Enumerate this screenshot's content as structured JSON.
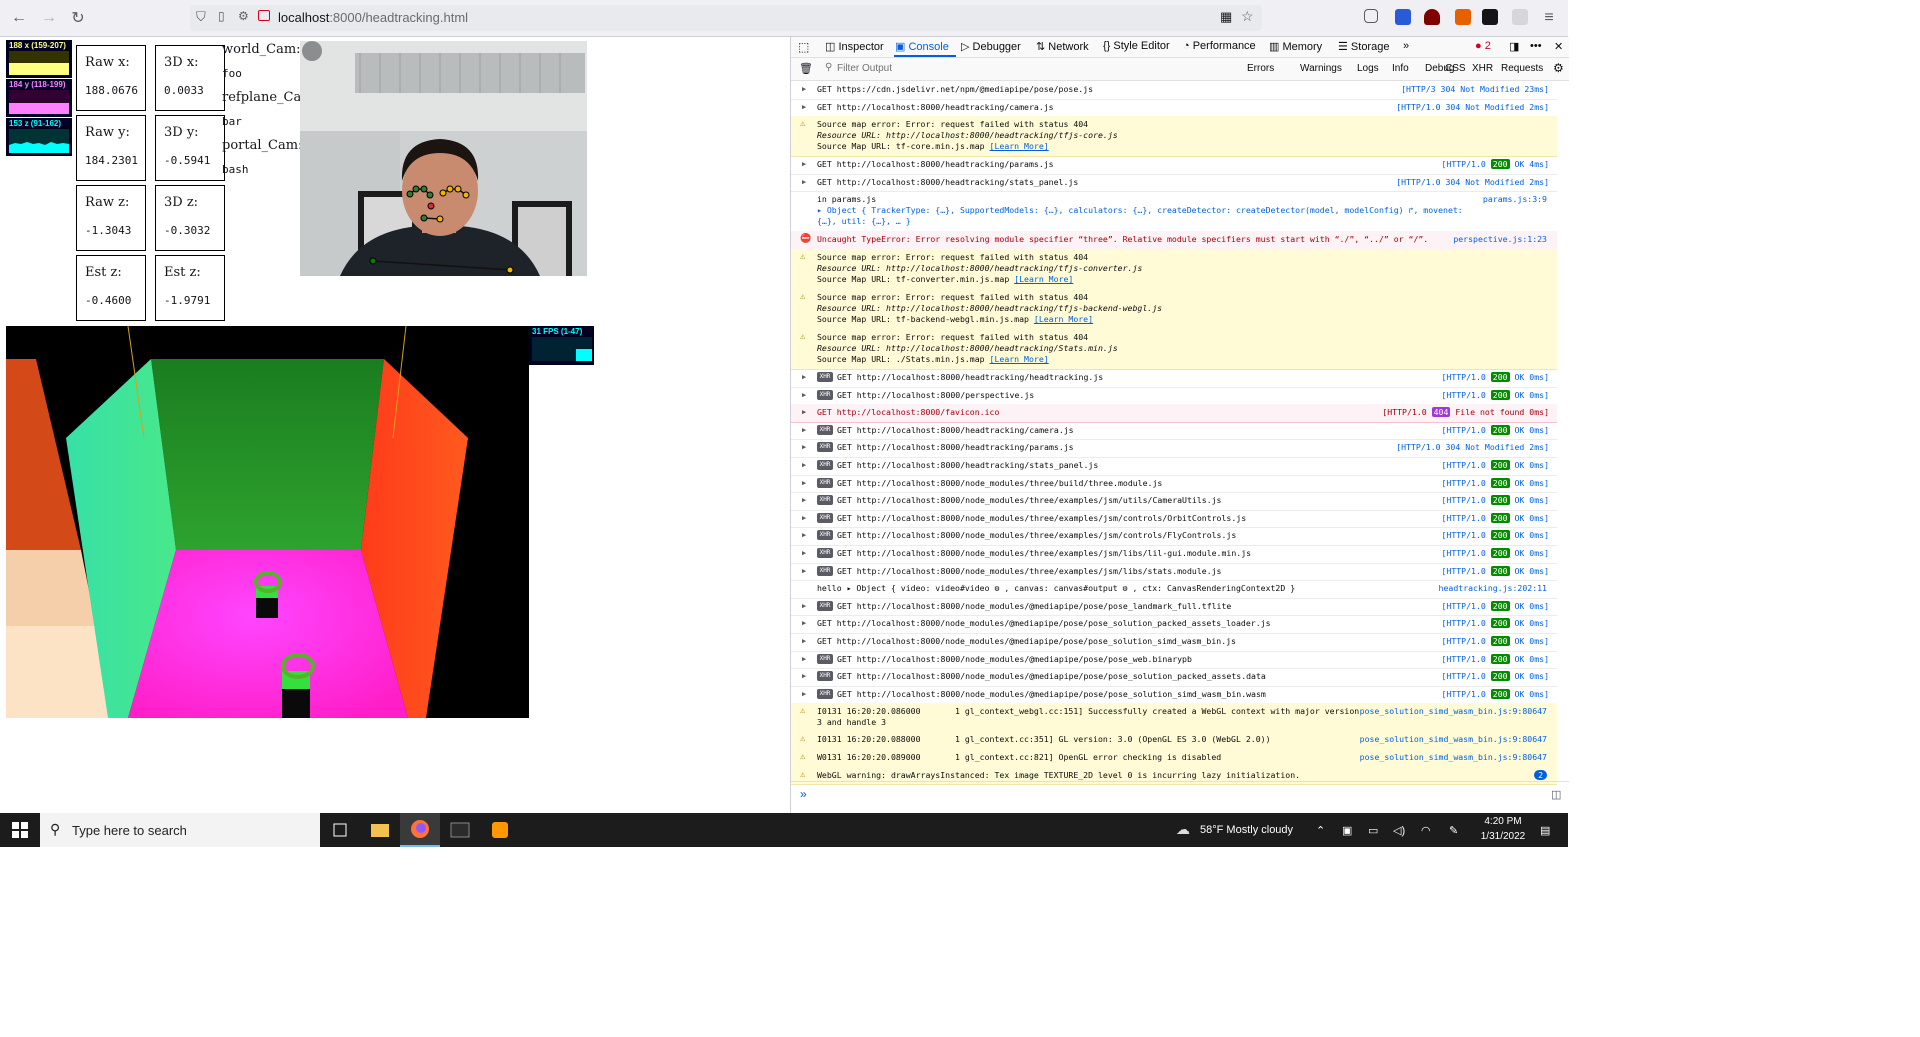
{
  "browser": {
    "url_host": "localhost",
    "url_path": ":8000/headtracking.html"
  },
  "stats_panels": [
    {
      "label": "188 x (159-207)",
      "color": "#ffff80"
    },
    {
      "label": "184 y (118-199)",
      "color": "#ff80ff"
    },
    {
      "label": "153 z (91-162)",
      "color": "#00ffff"
    }
  ],
  "readouts": [
    [
      {
        "label": "Raw x:",
        "value": "188.0676"
      },
      {
        "label": "3D x:",
        "value": "0.0033"
      }
    ],
    [
      {
        "label": "Raw y:",
        "value": "184.2301"
      },
      {
        "label": "3D y:",
        "value": "-0.5941"
      }
    ],
    [
      {
        "label": "Raw z:",
        "value": "-1.3043"
      },
      {
        "label": "3D z:",
        "value": "-0.3032"
      }
    ],
    [
      {
        "label": "Est z:",
        "value": "-0.4600"
      },
      {
        "label": "Est z:",
        "value": "-1.9791"
      }
    ]
  ],
  "cams": [
    {
      "label": "world_Cam:",
      "value": "foo"
    },
    {
      "label": "refplane_Cam:",
      "value": "bar"
    },
    {
      "label": "portal_Cam:",
      "value": "bash"
    }
  ],
  "fps_label": "31 FPS (1-47)",
  "devtools": {
    "tabs": [
      "Inspector",
      "Console",
      "Debugger",
      "Network",
      "Style Editor",
      "Performance",
      "Memory",
      "Storage"
    ],
    "error_count": "2",
    "filter_placeholder": "Filter Output",
    "filters": [
      "Errors",
      "Warnings",
      "Logs",
      "Info",
      "Debug",
      "CSS",
      "XHR",
      "Requests"
    ],
    "rows": [
      {
        "kind": "get",
        "xhr": false,
        "text": "GET https://cdn.jsdelivr.net/npm/@mediapipe/pose/pose.js",
        "status": "[HTTP/3 304 Not Modified 23ms]",
        "badge": ""
      },
      {
        "kind": "get",
        "xhr": false,
        "text": "GET http://localhost:8000/headtracking/camera.js",
        "status": "[HTTP/1.0 304 Not Modified 2ms]",
        "badge": ""
      },
      {
        "kind": "warn3",
        "lines": [
          "Source map error: Error: request failed with status 404",
          "Resource URL: http://localhost:8000/headtracking/tfjs-core.js",
          "Source Map URL: tf-core.min.js.map "
        ],
        "learn": "[Learn More]"
      },
      {
        "kind": "get",
        "xhr": false,
        "text": "GET http://localhost:8000/headtracking/params.js",
        "status_pre": "[HTTP/1.0 ",
        "badge": "200",
        "status_post": " OK 4ms]"
      },
      {
        "kind": "get",
        "xhr": false,
        "text": "GET http://localhost:8000/headtracking/stats_panel.js",
        "status": "[HTTP/1.0 304 Not Modified 2ms]",
        "badge": ""
      },
      {
        "kind": "log",
        "lines": [
          "in params.js",
          "▸ Object { TrackerType: {…}, SupportedModels: {…}, calculators: {…}, createDetector: createDetector(model, modelConfig) ↱, movenet:",
          "{…}, util: {…}, … }"
        ],
        "src": "params.js:3:9"
      },
      {
        "kind": "error",
        "text": "Uncaught TypeError: Error resolving module specifier “three”. Relative module specifiers must start with “./”, “../” or “/”.",
        "src": "perspective.js:1:23"
      },
      {
        "kind": "warn3",
        "lines": [
          "Source map error: Error: request failed with status 404",
          "Resource URL: http://localhost:8000/headtracking/tfjs-converter.js",
          "Source Map URL: tf-converter.min.js.map "
        ],
        "learn": "[Learn More]"
      },
      {
        "kind": "warn3",
        "lines": [
          "Source map error: Error: request failed with status 404",
          "Resource URL: http://localhost:8000/headtracking/tfjs-backend-webgl.js",
          "Source Map URL: tf-backend-webgl.min.js.map "
        ],
        "learn": "[Learn More]"
      },
      {
        "kind": "warn3",
        "lines": [
          "Source map error: Error: request failed with status 404",
          "Resource URL: http://localhost:8000/headtracking/Stats.min.js",
          "Source Map URL: ./Stats.min.js.map "
        ],
        "learn": "[Learn More]"
      },
      {
        "kind": "get",
        "xhr": true,
        "text": "GET http://localhost:8000/headtracking/headtracking.js",
        "status_pre": "[HTTP/1.0 ",
        "badge": "200",
        "status_post": " OK 0ms]"
      },
      {
        "kind": "get",
        "xhr": true,
        "text": "GET http://localhost:8000/perspective.js",
        "status_pre": "[HTTP/1.0 ",
        "badge": "200",
        "status_post": " OK 0ms]"
      },
      {
        "kind": "get404",
        "xhr": false,
        "text": "GET http://localhost:8000/favicon.ico",
        "status_pre": "[HTTP/1.0 ",
        "badge": "404",
        "status_post": " File not found 0ms]"
      },
      {
        "kind": "get",
        "xhr": true,
        "text": "GET http://localhost:8000/headtracking/camera.js",
        "status_pre": "[HTTP/1.0 ",
        "badge": "200",
        "status_post": " OK 0ms]"
      },
      {
        "kind": "get",
        "xhr": true,
        "text": "GET http://localhost:8000/headtracking/params.js",
        "status": "[HTTP/1.0 304 Not Modified 2ms]",
        "badge": ""
      },
      {
        "kind": "get",
        "xhr": true,
        "text": "GET http://localhost:8000/headtracking/stats_panel.js",
        "status_pre": "[HTTP/1.0 ",
        "badge": "200",
        "status_post": " OK 0ms]"
      },
      {
        "kind": "get",
        "xhr": true,
        "text": "GET http://localhost:8000/node_modules/three/build/three.module.js",
        "status_pre": "[HTTP/1.0 ",
        "badge": "200",
        "status_post": " OK 0ms]"
      },
      {
        "kind": "get",
        "xhr": true,
        "text": "GET http://localhost:8000/node_modules/three/examples/jsm/utils/CameraUtils.js",
        "status_pre": "[HTTP/1.0 ",
        "badge": "200",
        "status_post": " OK 0ms]"
      },
      {
        "kind": "get",
        "xhr": true,
        "text": "GET http://localhost:8000/node_modules/three/examples/jsm/controls/OrbitControls.js",
        "status_pre": "[HTTP/1.0 ",
        "badge": "200",
        "status_post": " OK 0ms]"
      },
      {
        "kind": "get",
        "xhr": true,
        "text": "GET http://localhost:8000/node_modules/three/examples/jsm/controls/FlyControls.js",
        "status_pre": "[HTTP/1.0 ",
        "badge": "200",
        "status_post": " OK 0ms]"
      },
      {
        "kind": "get",
        "xhr": true,
        "text": "GET http://localhost:8000/node_modules/three/examples/jsm/libs/lil-gui.module.min.js",
        "status_pre": "[HTTP/1.0 ",
        "badge": "200",
        "status_post": " OK 0ms]"
      },
      {
        "kind": "get",
        "xhr": true,
        "text": "GET http://localhost:8000/node_modules/three/examples/jsm/libs/stats.module.js",
        "status_pre": "[HTTP/1.0 ",
        "badge": "200",
        "status_post": " OK 0ms]"
      },
      {
        "kind": "hello",
        "text": "hello ▸ Object { video: video#video ⚙ , canvas: canvas#output ⚙ , ctx: CanvasRenderingContext2D }",
        "src": "headtracking.js:202:11"
      },
      {
        "kind": "get",
        "xhr": true,
        "text": "GET http://localhost:8000/node_modules/@mediapipe/pose/pose_landmark_full.tflite",
        "status_pre": "[HTTP/1.0 ",
        "badge": "200",
        "status_post": " OK 0ms]"
      },
      {
        "kind": "get",
        "xhr": false,
        "text": "GET http://localhost:8000/node_modules/@mediapipe/pose/pose_solution_packed_assets_loader.js",
        "status_pre": "[HTTP/1.0 ",
        "badge": "200",
        "status_post": " OK 0ms]"
      },
      {
        "kind": "get",
        "xhr": false,
        "text": "GET http://localhost:8000/node_modules/@mediapipe/pose/pose_solution_simd_wasm_bin.js",
        "status_pre": "[HTTP/1.0 ",
        "badge": "200",
        "status_post": " OK 0ms]"
      },
      {
        "kind": "get",
        "xhr": true,
        "text": "GET http://localhost:8000/node_modules/@mediapipe/pose/pose_web.binarypb",
        "status_pre": "[HTTP/1.0 ",
        "badge": "200",
        "status_post": " OK 0ms]"
      },
      {
        "kind": "get",
        "xhr": true,
        "text": "GET http://localhost:8000/node_modules/@mediapipe/pose/pose_solution_packed_assets.data",
        "status_pre": "[HTTP/1.0 ",
        "badge": "200",
        "status_post": " OK 0ms]"
      },
      {
        "kind": "get",
        "xhr": true,
        "text": "GET http://localhost:8000/node_modules/@mediapipe/pose/pose_solution_simd_wasm_bin.wasm",
        "status_pre": "[HTTP/1.0 ",
        "badge": "200",
        "status_post": " OK 0ms]"
      },
      {
        "kind": "warn2",
        "lines": [
          "I0131 16:20:20.086000       1 gl_context_webgl.cc:151] Successfully created a WebGL context with major version",
          "3 and handle 3"
        ],
        "src": "pose_solution_simd_wasm_bin.js:9:80647"
      },
      {
        "kind": "warn1",
        "text": "I0131 16:20:20.088000       1 gl_context.cc:351] GL version: 3.0 (OpenGL ES 3.0 (WebGL 2.0))",
        "src": "pose_solution_simd_wasm_bin.js:9:80647"
      },
      {
        "kind": "warn1",
        "text": "W0131 16:20:20.089000       1 gl_context.cc:821] OpenGL error checking is disabled",
        "src": "pose_solution_simd_wasm_bin.js:9:80647"
      },
      {
        "kind": "warn1",
        "text": "WebGL warning: drawArraysInstanced: Tex image TEXTURE_2D level 0 is incurring lazy initialization.",
        "src": "2"
      }
    ]
  },
  "taskbar": {
    "search_placeholder": "Type here to search",
    "weather": "58°F  Mostly cloudy",
    "time": "4:20 PM",
    "date": "1/31/2022"
  }
}
